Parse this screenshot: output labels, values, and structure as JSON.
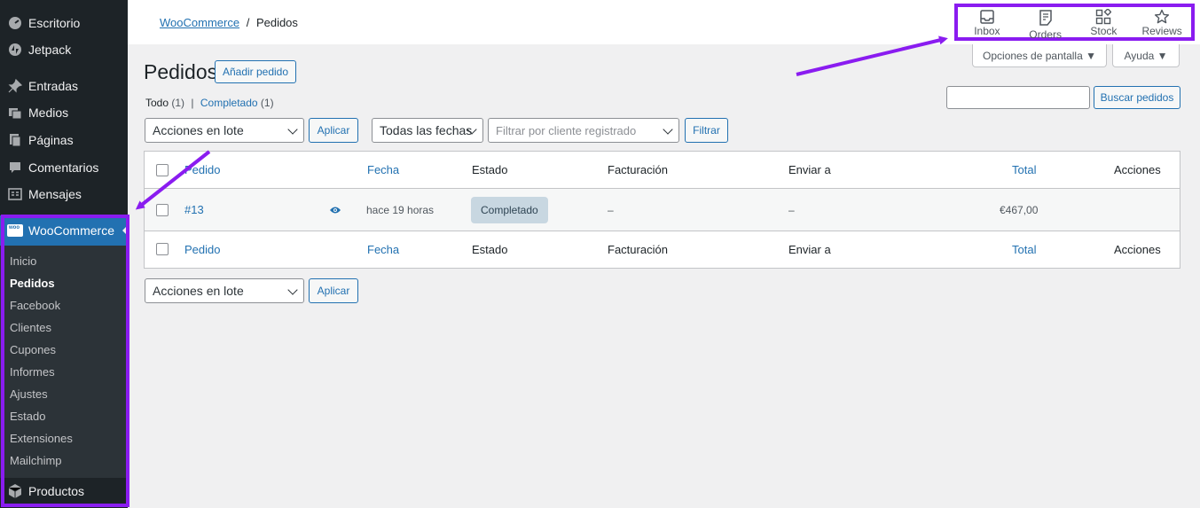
{
  "sidebar": {
    "top_items": [
      {
        "label": "Escritorio",
        "icon": "dashboard-icon"
      },
      {
        "label": "Jetpack",
        "icon": "jetpack-icon"
      },
      {
        "label": "Entradas",
        "icon": "pin-icon"
      },
      {
        "label": "Medios",
        "icon": "media-icon"
      },
      {
        "label": "Páginas",
        "icon": "pages-icon"
      },
      {
        "label": "Comentarios",
        "icon": "comments-icon"
      },
      {
        "label": "Mensajes",
        "icon": "messages-icon"
      }
    ],
    "woocommerce_label": "WooCommerce",
    "submenu": [
      "Inicio",
      "Pedidos",
      "Facebook",
      "Clientes",
      "Cupones",
      "Informes",
      "Ajustes",
      "Estado",
      "Extensiones",
      "Mailchimp"
    ],
    "products_label": "Productos",
    "highlight_color": "#8a1cf0"
  },
  "header": {
    "breadcrumb_link": "WooCommerce",
    "breadcrumb_sep": "/",
    "breadcrumb_current": "Pedidos",
    "activity": [
      {
        "label": "Inbox",
        "icon": "inbox-icon"
      },
      {
        "label": "Orders",
        "icon": "orders-icon"
      },
      {
        "label": "Stock",
        "icon": "stock-icon"
      },
      {
        "label": "Reviews",
        "icon": "star-icon"
      }
    ]
  },
  "screen_options": {
    "label": "Opciones de pantalla ▼",
    "help": "Ayuda ▼"
  },
  "page": {
    "title": "Pedidos",
    "add_button": "Añadir pedido",
    "filter_all": "Todo",
    "filter_all_count": "(1)",
    "filter_sep": "|",
    "filter_completed": "Completado",
    "filter_completed_count": "(1)",
    "search_value": "",
    "search_button": "Buscar pedidos",
    "bulk_actions": "Acciones en lote",
    "apply": "Aplicar",
    "all_dates": "Todas las fechas",
    "customer_placeholder": "Filtrar por cliente registrado",
    "filter_button": "Filtrar"
  },
  "table": {
    "columns": [
      "Pedido",
      "Fecha",
      "Estado",
      "Facturación",
      "Enviar a",
      "Total",
      "Acciones"
    ],
    "rows": [
      {
        "order": "#13",
        "date": "hace 19 horas",
        "status": "Completado",
        "billing": "–",
        "ship_to": "–",
        "total": "€467,00"
      }
    ]
  },
  "colors": {
    "accent": "#2271b1",
    "annotation": "#8a1cf0",
    "sidebar": "#1d2327"
  }
}
